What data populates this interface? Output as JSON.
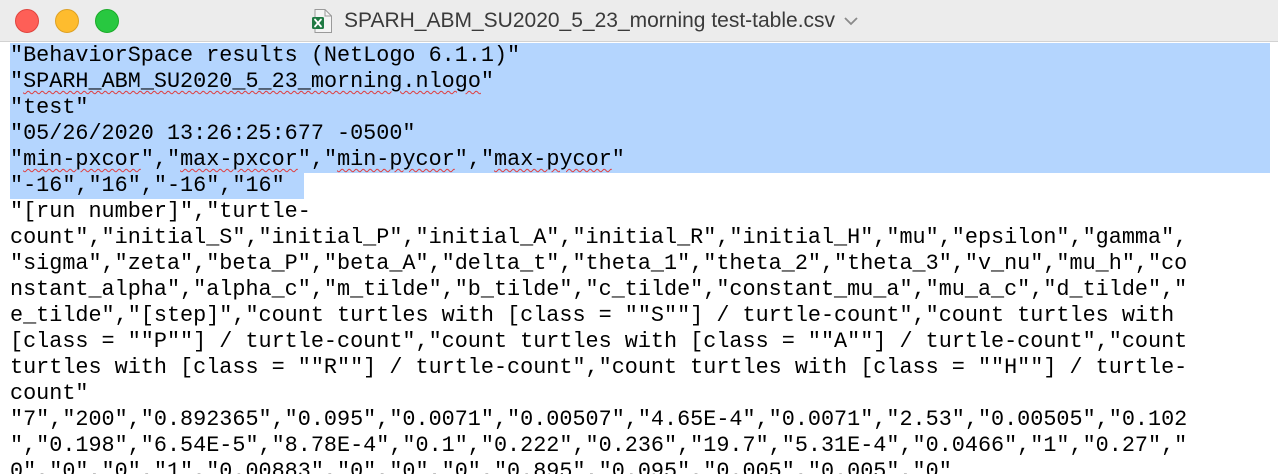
{
  "window": {
    "title": "SPARH_ABM_SU2020_5_23_morning test-table.csv",
    "file_icon": "excel-csv-document-icon",
    "controls": [
      "close",
      "minimize",
      "zoom"
    ]
  },
  "document": {
    "lines": [
      "\"BehaviorSpace results (NetLogo 6.1.1)\"",
      "\"SPARH_ABM_SU2020_5_23_morning.nlogo\"",
      "\"test\"",
      "\"05/26/2020 13:26:25:677 -0500\"",
      "\"min-pxcor\",\"max-pxcor\",\"min-pycor\",\"max-pycor\"",
      "\"-16\",\"16\",\"-16\",\"16\"",
      "\"[run number]\",\"turtle-",
      "count\",\"initial_S\",\"initial_P\",\"initial_A\",\"initial_R\",\"initial_H\",\"mu\",\"epsilon\",\"gamma\",",
      "\"sigma\",\"zeta\",\"beta_P\",\"beta_A\",\"delta_t\",\"theta_1\",\"theta_2\",\"theta_3\",\"v_nu\",\"mu_h\",\"co",
      "nstant_alpha\",\"alpha_c\",\"m_tilde\",\"b_tilde\",\"c_tilde\",\"constant_mu_a\",\"mu_a_c\",\"d_tilde\",\"",
      "e_tilde\",\"[step]\",\"count turtles with [class = \"\"S\"\"] / turtle-count\",\"count turtles with",
      "[class = \"\"P\"\"] / turtle-count\",\"count turtles with [class = \"\"A\"\"] / turtle-count\",\"count",
      "turtles with [class = \"\"R\"\"] / turtle-count\",\"count turtles with [class = \"\"H\"\"] / turtle-",
      "count\"",
      "\"7\",\"200\",\"0.892365\",\"0.095\",\"0.0071\",\"0.00507\",\"4.65E-4\",\"0.0071\",\"2.53\",\"0.00505\",\"0.102",
      "\",\"0.198\",\"6.54E-5\",\"8.78E-4\",\"0.1\",\"0.222\",\"0.236\",\"19.7\",\"5.31E-4\",\"0.0466\",\"1\",\"0.27\",\"",
      "0\",\"0\",\"0\",\"1\",\"0.00883\",\"0\",\"0\",\"0\",\"0.895\",\"0.095\",\"0.005\",\"0.005\",\"0\""
    ]
  }
}
